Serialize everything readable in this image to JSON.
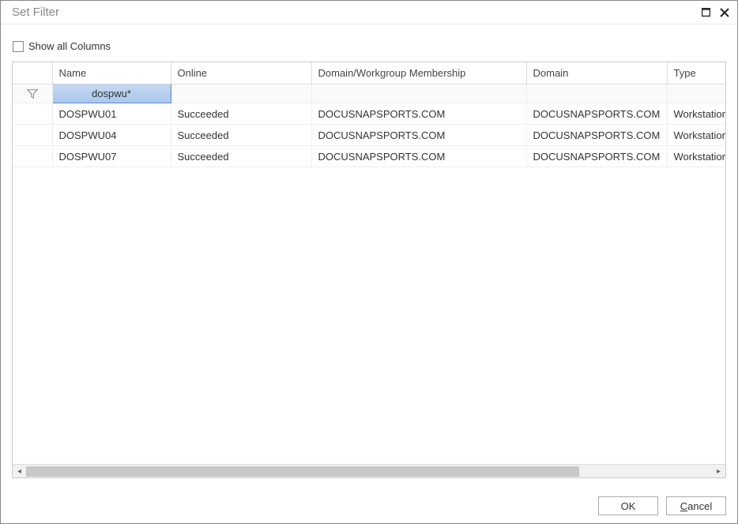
{
  "window": {
    "title": "Set Filter"
  },
  "options": {
    "show_all_columns_label": "Show all Columns"
  },
  "grid": {
    "headers": {
      "icon": "",
      "name": "Name",
      "online": "Online",
      "domain_membership": "Domain/Workgroup Membership",
      "domain": "Domain",
      "type": "Type"
    },
    "filter": {
      "name": "dospwu*"
    },
    "rows": [
      {
        "name": "DOSPWU01",
        "online": "Succeeded",
        "domain_membership": "DOCUSNAPSPORTS.COM",
        "domain": "DOCUSNAPSPORTS.COM",
        "type": "Workstation"
      },
      {
        "name": "DOSPWU04",
        "online": "Succeeded",
        "domain_membership": "DOCUSNAPSPORTS.COM",
        "domain": "DOCUSNAPSPORTS.COM",
        "type": "Workstation"
      },
      {
        "name": "DOSPWU07",
        "online": "Succeeded",
        "domain_membership": "DOCUSNAPSPORTS.COM",
        "domain": "DOCUSNAPSPORTS.COM",
        "type": "Workstation"
      }
    ]
  },
  "buttons": {
    "ok": "OK",
    "cancel": "Cancel"
  }
}
